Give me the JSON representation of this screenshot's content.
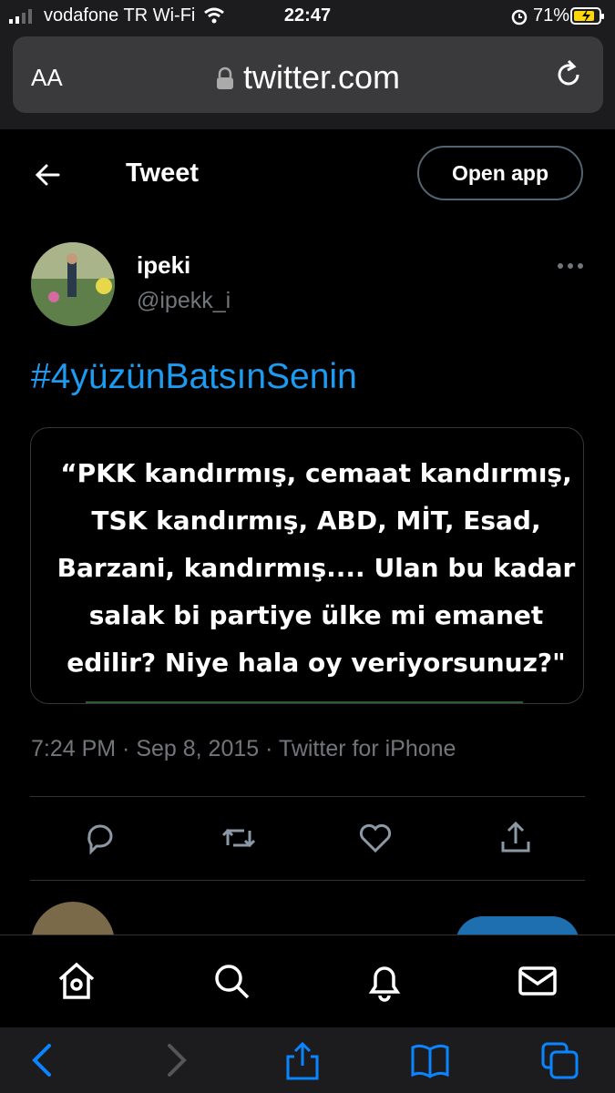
{
  "status_bar": {
    "carrier": "vodafone TR Wi-Fi",
    "time": "22:47",
    "battery": "71%"
  },
  "browser": {
    "text_size_label": "AA",
    "url": "twitter.com"
  },
  "header": {
    "title": "Tweet",
    "open_app_label": "Open app"
  },
  "tweet": {
    "author_name": "ipeki",
    "author_handle": "@ipekk_i",
    "hashtag": "#4yüzünBatsınSenin",
    "image_quote": "“PKK kandırmış, cemaat kandırmış, TSK kandırmış, ABD, MİT, Esad, Barzani, kandırmış.... Ulan bu kadar salak bi partiye ülke mi emanet edilir? Niye hala oy veriyorsunuz?\"",
    "timestamp": "7:24 PM · Sep 8, 2015 · Twitter for iPhone"
  },
  "colors": {
    "accent": "#1d9bf0",
    "background": "#000000",
    "secondary_text": "#71767b"
  }
}
